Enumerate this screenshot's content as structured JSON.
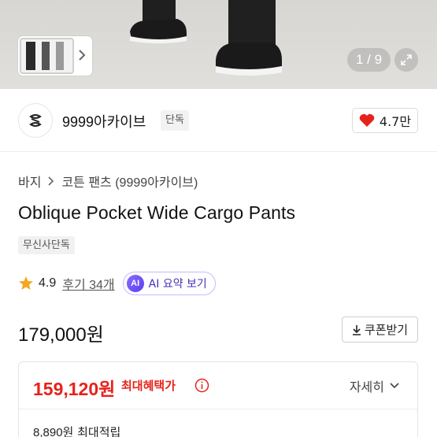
{
  "gallery": {
    "counter": "1 / 9"
  },
  "brand": {
    "name": "9999아카이브",
    "tag": "단독",
    "likes": "4.7만"
  },
  "breadcrumb": {
    "category": "바지",
    "subcategory": "코튼 팬츠 (9999아카이브)"
  },
  "product": {
    "title": "Oblique Pocket Wide Cargo Pants",
    "exclusive_badge": "무신사단독",
    "rating": "4.9",
    "review_link": "후기 34개",
    "ai_badge": "AI",
    "ai_summary_label": "AI 요약 보기",
    "price": "179,000원",
    "coupon_label": "쿠폰받기"
  },
  "benefit": {
    "max_price": "159,120원",
    "max_label": "최대혜택가",
    "detail_label": "자세히",
    "points_value": "8,890원",
    "points_label": "최대적립"
  },
  "colors": {
    "accent_red": "#e7221b",
    "heart_red": "#e7221b",
    "star": "#f5a623",
    "ai_purple": "#5a3df0"
  }
}
